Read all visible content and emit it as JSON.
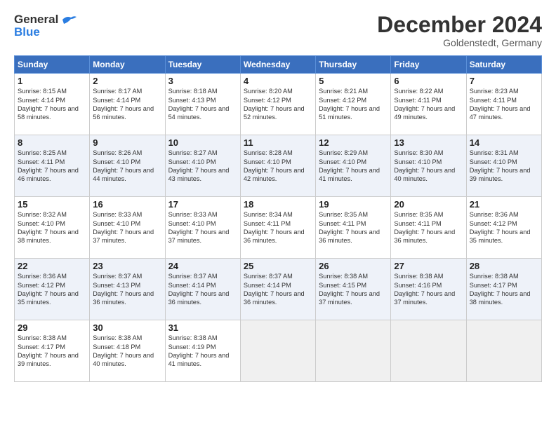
{
  "header": {
    "logo_line1": "General",
    "logo_line2": "Blue",
    "main_title": "December 2024",
    "subtitle": "Goldenstedt, Germany"
  },
  "calendar": {
    "days_of_week": [
      "Sunday",
      "Monday",
      "Tuesday",
      "Wednesday",
      "Thursday",
      "Friday",
      "Saturday"
    ],
    "weeks": [
      [
        null,
        {
          "day": 2,
          "sunrise": "8:17 AM",
          "sunset": "4:14 PM",
          "daylight": "7 hours and 56 minutes."
        },
        {
          "day": 3,
          "sunrise": "8:18 AM",
          "sunset": "4:13 PM",
          "daylight": "7 hours and 54 minutes."
        },
        {
          "day": 4,
          "sunrise": "8:20 AM",
          "sunset": "4:12 PM",
          "daylight": "7 hours and 52 minutes."
        },
        {
          "day": 5,
          "sunrise": "8:21 AM",
          "sunset": "4:12 PM",
          "daylight": "7 hours and 51 minutes."
        },
        {
          "day": 6,
          "sunrise": "8:22 AM",
          "sunset": "4:11 PM",
          "daylight": "7 hours and 49 minutes."
        },
        {
          "day": 7,
          "sunrise": "8:23 AM",
          "sunset": "4:11 PM",
          "daylight": "7 hours and 47 minutes."
        }
      ],
      [
        {
          "day": 1,
          "sunrise": "8:15 AM",
          "sunset": "4:14 PM",
          "daylight": "7 hours and 58 minutes."
        },
        null,
        null,
        null,
        null,
        null,
        null
      ],
      [
        {
          "day": 8,
          "sunrise": "8:25 AM",
          "sunset": "4:11 PM",
          "daylight": "7 hours and 46 minutes."
        },
        {
          "day": 9,
          "sunrise": "8:26 AM",
          "sunset": "4:10 PM",
          "daylight": "7 hours and 44 minutes."
        },
        {
          "day": 10,
          "sunrise": "8:27 AM",
          "sunset": "4:10 PM",
          "daylight": "7 hours and 43 minutes."
        },
        {
          "day": 11,
          "sunrise": "8:28 AM",
          "sunset": "4:10 PM",
          "daylight": "7 hours and 42 minutes."
        },
        {
          "day": 12,
          "sunrise": "8:29 AM",
          "sunset": "4:10 PM",
          "daylight": "7 hours and 41 minutes."
        },
        {
          "day": 13,
          "sunrise": "8:30 AM",
          "sunset": "4:10 PM",
          "daylight": "7 hours and 40 minutes."
        },
        {
          "day": 14,
          "sunrise": "8:31 AM",
          "sunset": "4:10 PM",
          "daylight": "7 hours and 39 minutes."
        }
      ],
      [
        {
          "day": 15,
          "sunrise": "8:32 AM",
          "sunset": "4:10 PM",
          "daylight": "7 hours and 38 minutes."
        },
        {
          "day": 16,
          "sunrise": "8:33 AM",
          "sunset": "4:10 PM",
          "daylight": "7 hours and 37 minutes."
        },
        {
          "day": 17,
          "sunrise": "8:33 AM",
          "sunset": "4:10 PM",
          "daylight": "7 hours and 37 minutes."
        },
        {
          "day": 18,
          "sunrise": "8:34 AM",
          "sunset": "4:11 PM",
          "daylight": "7 hours and 36 minutes."
        },
        {
          "day": 19,
          "sunrise": "8:35 AM",
          "sunset": "4:11 PM",
          "daylight": "7 hours and 36 minutes."
        },
        {
          "day": 20,
          "sunrise": "8:35 AM",
          "sunset": "4:11 PM",
          "daylight": "7 hours and 36 minutes."
        },
        {
          "day": 21,
          "sunrise": "8:36 AM",
          "sunset": "4:12 PM",
          "daylight": "7 hours and 35 minutes."
        }
      ],
      [
        {
          "day": 22,
          "sunrise": "8:36 AM",
          "sunset": "4:12 PM",
          "daylight": "7 hours and 35 minutes."
        },
        {
          "day": 23,
          "sunrise": "8:37 AM",
          "sunset": "4:13 PM",
          "daylight": "7 hours and 36 minutes."
        },
        {
          "day": 24,
          "sunrise": "8:37 AM",
          "sunset": "4:14 PM",
          "daylight": "7 hours and 36 minutes."
        },
        {
          "day": 25,
          "sunrise": "8:37 AM",
          "sunset": "4:14 PM",
          "daylight": "7 hours and 36 minutes."
        },
        {
          "day": 26,
          "sunrise": "8:38 AM",
          "sunset": "4:15 PM",
          "daylight": "7 hours and 37 minutes."
        },
        {
          "day": 27,
          "sunrise": "8:38 AM",
          "sunset": "4:16 PM",
          "daylight": "7 hours and 37 minutes."
        },
        {
          "day": 28,
          "sunrise": "8:38 AM",
          "sunset": "4:17 PM",
          "daylight": "7 hours and 38 minutes."
        }
      ],
      [
        {
          "day": 29,
          "sunrise": "8:38 AM",
          "sunset": "4:17 PM",
          "daylight": "7 hours and 39 minutes."
        },
        {
          "day": 30,
          "sunrise": "8:38 AM",
          "sunset": "4:18 PM",
          "daylight": "7 hours and 40 minutes."
        },
        {
          "day": 31,
          "sunrise": "8:38 AM",
          "sunset": "4:19 PM",
          "daylight": "7 hours and 41 minutes."
        },
        null,
        null,
        null,
        null
      ]
    ]
  }
}
